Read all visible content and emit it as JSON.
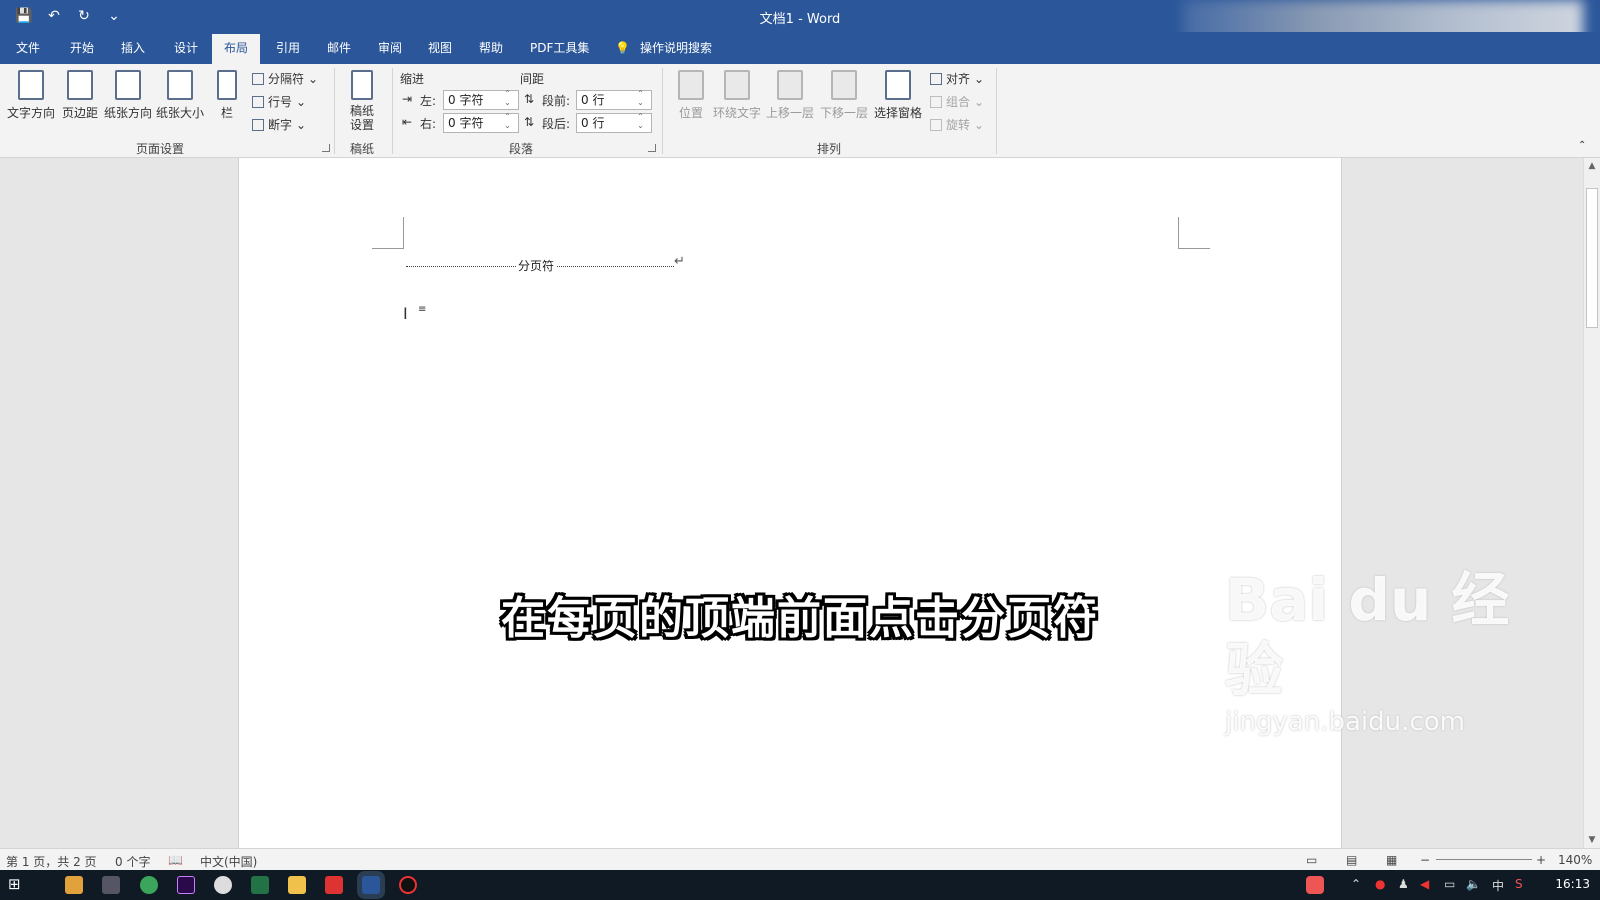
{
  "window": {
    "title": "文档1  -  Word"
  },
  "tabs": [
    "文件",
    "开始",
    "插入",
    "设计",
    "布局",
    "引用",
    "邮件",
    "审阅",
    "视图",
    "帮助",
    "PDF工具集"
  ],
  "active_tab": "布局",
  "tell_me": "操作说明搜索",
  "ribbon": {
    "page_setup": {
      "buttons": [
        "文字方向",
        "页边距",
        "纸张方向",
        "纸张大小",
        "栏"
      ],
      "small": [
        "分隔符",
        "行号",
        "断字"
      ],
      "label": "页面设置"
    },
    "draft": {
      "button": "稿纸设置",
      "label": "稿纸"
    },
    "paragraph": {
      "indent_header": "缩进",
      "spacing_header": "间距",
      "left_label": "左:",
      "right_label": "右:",
      "before_label": "段前:",
      "after_label": "段后:",
      "left_value": "0 字符",
      "right_value": "0 字符",
      "before_value": "0 行",
      "after_value": "0 行",
      "label": "段落"
    },
    "arrange": {
      "buttons": [
        "位置",
        "环绕文字",
        "上移一层",
        "下移一层",
        "选择窗格"
      ],
      "small": [
        "对齐",
        "组合",
        "旋转"
      ],
      "label": "排列"
    }
  },
  "document": {
    "page_break_label": "分页符"
  },
  "subtitle": "在每页的顶端前面点击分页符",
  "watermark": {
    "brand": "Bai du 经验",
    "url": "jingyan.baidu.com"
  },
  "status": {
    "page": "第 1 页，共 2 页",
    "words": "0 个字",
    "language": "中文(中国)",
    "zoom": "140%"
  },
  "taskbar": {
    "time": "16:13",
    "ime": "中"
  }
}
